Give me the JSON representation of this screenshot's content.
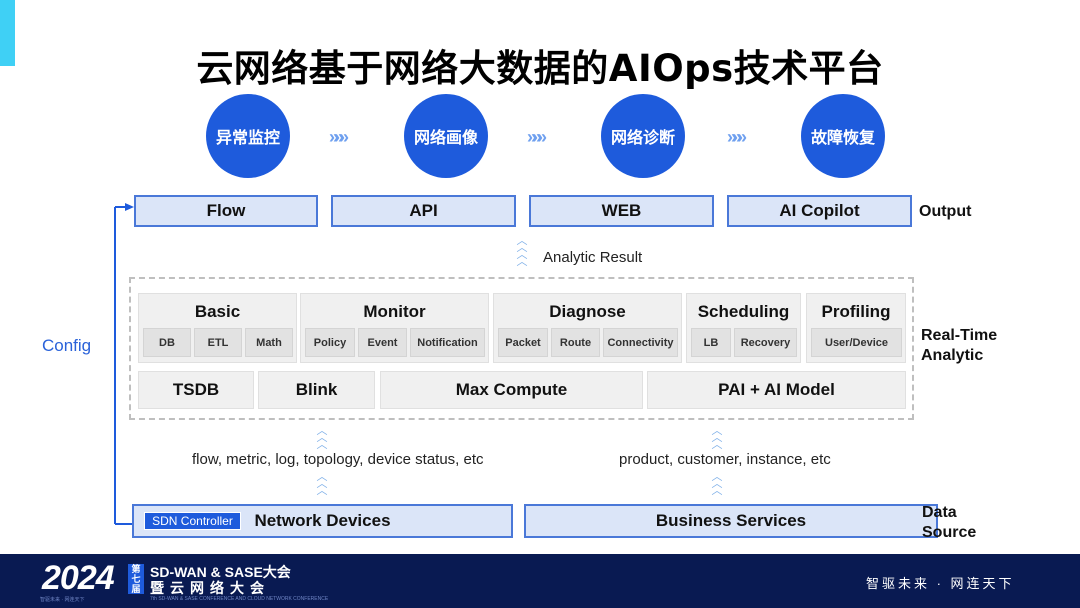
{
  "title": "云网络基于网络大数据的AIOps技术平台",
  "steps": [
    "异常监控",
    "网络画像",
    "网络诊断",
    "故障恢复"
  ],
  "step_arrow": "»»»",
  "outputs": [
    "Flow",
    "API",
    "WEB",
    "AI Copilot"
  ],
  "output_label": "Output",
  "analytic_result": "Analytic Result",
  "config_label": "Config",
  "realtime_label": "Real-Time\nAnalytic",
  "groups": [
    {
      "title": "Basic",
      "items": [
        "DB",
        "ETL",
        "Math"
      ]
    },
    {
      "title": "Monitor",
      "items": [
        "Policy",
        "Event",
        "Notification"
      ]
    },
    {
      "title": "Diagnose",
      "items": [
        "Packet",
        "Route",
        "Connectivity"
      ]
    },
    {
      "title": "Scheduling",
      "items": [
        "LB",
        "Recovery"
      ]
    },
    {
      "title": "Profiling",
      "items": [
        "User/Device"
      ]
    }
  ],
  "base_components": [
    "TSDB",
    "Blink",
    "Max Compute",
    "PAI + AI Model"
  ],
  "left_data": "flow, metric, log, topology, device status, etc",
  "right_data": "product, customer, instance, etc",
  "sources": {
    "controller": "SDN Controller",
    "network": "Network Devices",
    "business": "Business Services"
  },
  "data_source_label": "Data\nSource",
  "footer": {
    "year": "2024",
    "year_sub": "智驱未来 · 网连天下",
    "badge": "第七届",
    "conf_line1": "SD-WAN & SASE大会",
    "conf_line2": "暨云网络大会",
    "conf_line3": "7th SD-WAN & SASE CONFERENCE AND CLOUD NETWORK CONFERENCE",
    "slogan": "智驱未来 · 网连天下"
  },
  "colors": {
    "accent": "#1e5bdc",
    "box_fill": "#dbe5f8",
    "box_border": "#4a78d8",
    "footer_bg": "#091a52",
    "config_text": "#2a62d9"
  }
}
